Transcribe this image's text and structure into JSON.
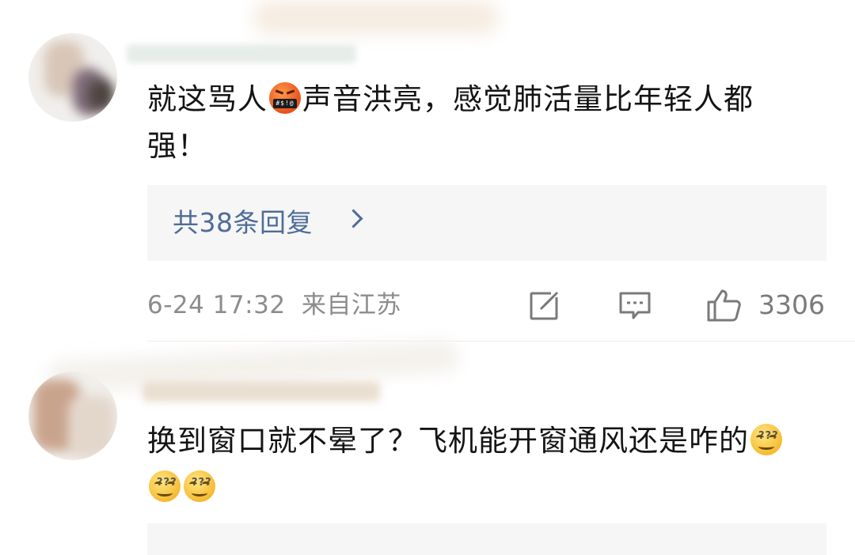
{
  "comments": [
    {
      "text_before_emoji": "就这骂人",
      "emoji_name": "angry-swearing-face",
      "emoji_caption": "#$!@",
      "text_after_emoji": "声音洪亮，感觉肺活量比年轻人都强！",
      "replies_label": "共38条回复",
      "date": "6-24 17:32",
      "location": "来自江苏",
      "likes": "3306"
    },
    {
      "text": "换到窗口就不晕了？飞机能开窗通风还是咋的",
      "emoji_name": "dizzy-face",
      "emoji_caption": "???",
      "emoji_count": 3
    }
  ],
  "icons": {
    "share": "share-icon",
    "comment": "comment-icon",
    "like": "thumbs-up-icon"
  },
  "colors": {
    "link": "#4f6c97",
    "meta": "#8c8c8c",
    "reply_bg": "#f6f6f6"
  }
}
